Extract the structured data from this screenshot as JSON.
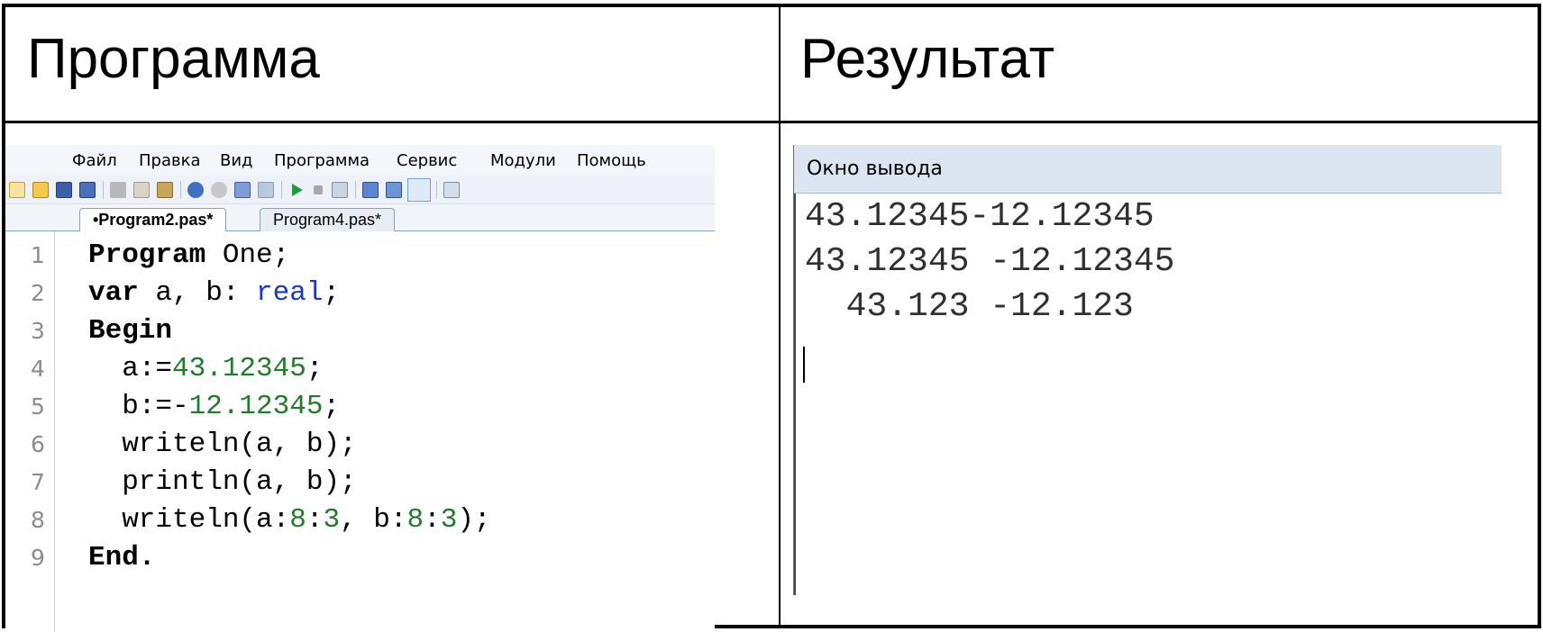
{
  "headers": {
    "program": "Программа",
    "result": "Результат"
  },
  "ide": {
    "menu": [
      "Файл",
      "Правка",
      "Вид",
      "Программа",
      "Сервис",
      "Модули",
      "Помощь"
    ],
    "tabs": [
      {
        "label": "•Program2.pas*",
        "active": true
      },
      {
        "label": "Program4.pas*",
        "active": false
      }
    ],
    "line_numbers": [
      "1",
      "2",
      "3",
      "4",
      "5",
      "6",
      "7",
      "8",
      "9"
    ],
    "code": [
      [
        {
          "t": "Program",
          "c": "kw"
        },
        {
          "t": " One;",
          "c": ""
        }
      ],
      [
        {
          "t": "var",
          "c": "kw"
        },
        {
          "t": " a, b: ",
          "c": ""
        },
        {
          "t": "real",
          "c": "typ"
        },
        {
          "t": ";",
          "c": ""
        }
      ],
      [
        {
          "t": "Begin",
          "c": "kw"
        }
      ],
      [
        {
          "t": "  a:=",
          "c": ""
        },
        {
          "t": "43.12345",
          "c": "num"
        },
        {
          "t": ";",
          "c": ""
        }
      ],
      [
        {
          "t": "  b:=-",
          "c": ""
        },
        {
          "t": "12.12345",
          "c": "num"
        },
        {
          "t": ";",
          "c": ""
        }
      ],
      [
        {
          "t": "  writeln(a, b);",
          "c": ""
        }
      ],
      [
        {
          "t": "  println(a, b);",
          "c": ""
        }
      ],
      [
        {
          "t": "  writeln(a:",
          "c": ""
        },
        {
          "t": "8",
          "c": "num"
        },
        {
          "t": ":",
          "c": ""
        },
        {
          "t": "3",
          "c": "num"
        },
        {
          "t": ", b:",
          "c": ""
        },
        {
          "t": "8",
          "c": "num"
        },
        {
          "t": ":",
          "c": ""
        },
        {
          "t": "3",
          "c": "num"
        },
        {
          "t": ");",
          "c": ""
        }
      ],
      [
        {
          "t": "End.",
          "c": "kw"
        }
      ]
    ]
  },
  "output": {
    "title": "Окно вывода",
    "lines": [
      "43.12345-12.12345",
      "43.12345 -12.12345",
      "  43.123 -12.123"
    ]
  }
}
